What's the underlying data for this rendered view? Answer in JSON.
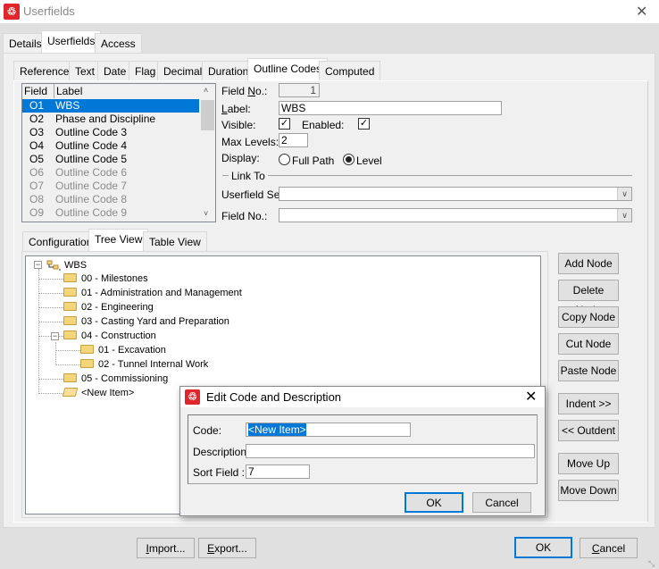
{
  "window": {
    "title": "Userfields",
    "app_icon": "app-logo-icon",
    "close_icon": "close-icon"
  },
  "top_tabs": [
    {
      "label": "Details"
    },
    {
      "label": "Userfields",
      "active": true
    },
    {
      "label": "Access"
    }
  ],
  "type_tabs": [
    {
      "label": "Reference"
    },
    {
      "label": "Text"
    },
    {
      "label": "Date"
    },
    {
      "label": "Flag"
    },
    {
      "label": "Decimal"
    },
    {
      "label": "Duration"
    },
    {
      "label": "Outline Codes",
      "active": true
    },
    {
      "label": "Computed"
    }
  ],
  "field_list": {
    "headers": {
      "field": "Field",
      "label": "Label"
    },
    "rows": [
      {
        "field": "O1",
        "label": "WBS",
        "selected": true
      },
      {
        "field": "O2",
        "label": "Phase and Discipline"
      },
      {
        "field": "O3",
        "label": "Outline Code 3"
      },
      {
        "field": "O4",
        "label": "Outline Code 4"
      },
      {
        "field": "O5",
        "label": "Outline Code 5"
      },
      {
        "field": "O6",
        "label": "Outline Code 6",
        "disabled": true
      },
      {
        "field": "O7",
        "label": "Outline Code 7",
        "disabled": true
      },
      {
        "field": "O8",
        "label": "Outline Code 8",
        "disabled": true
      },
      {
        "field": "O9",
        "label": "Outline Code 9",
        "disabled": true
      }
    ]
  },
  "props": {
    "field_no_label": "Field No.:",
    "field_no_value": "1",
    "label_label": "Label:",
    "label_value": "WBS",
    "visible_label": "Visible:",
    "visible_checked": true,
    "enabled_label": "Enabled:",
    "enabled_checked": true,
    "max_levels_label": "Max Levels:",
    "max_levels_value": "2",
    "display_label": "Display:",
    "display_options": [
      "Full Path",
      "Level"
    ],
    "display_selected": "Level",
    "link_to_label": "Link To",
    "userfield_set_label": "Userfield Set:",
    "userfield_set_value": "",
    "link_field_no_label": "Field No.:",
    "link_field_no_value": ""
  },
  "view_tabs": [
    {
      "label": "Configuration"
    },
    {
      "label": "Tree View",
      "active": true
    },
    {
      "label": "Table View"
    }
  ],
  "tree": {
    "root": "WBS",
    "nodes": [
      {
        "label": "00 - Milestones",
        "level": 1
      },
      {
        "label": "01 - Administration and Management",
        "level": 1
      },
      {
        "label": "02 - Engineering",
        "level": 1
      },
      {
        "label": "03 - Casting Yard and Preparation",
        "level": 1
      },
      {
        "label": "04 - Construction",
        "level": 1,
        "expanded": true
      },
      {
        "label": "01 - Excavation",
        "level": 2
      },
      {
        "label": "02 - Tunnel Internal Work",
        "level": 2
      },
      {
        "label": "05 - Commissioning",
        "level": 1
      },
      {
        "label": "<New Item>",
        "level": 1,
        "open": true
      }
    ]
  },
  "node_buttons": [
    "Add Node",
    "Delete Node",
    "Copy Node",
    "Cut Node",
    "Paste Node",
    "Indent >>",
    "<< Outdent",
    "Move Up",
    "Move Down"
  ],
  "edit_dialog": {
    "title": "Edit Code and Description",
    "code_label": "Code:",
    "code_value": "<New Item>",
    "description_label": "Description:",
    "description_value": "",
    "sort_label": "Sort Field :",
    "sort_value": "7",
    "ok": "OK",
    "cancel": "Cancel"
  },
  "footer": {
    "import": "Import...",
    "export": "Export...",
    "ok": "OK",
    "cancel": "Cancel"
  },
  "colors": {
    "selection": "#0078d7",
    "brand": "#e0252b"
  }
}
